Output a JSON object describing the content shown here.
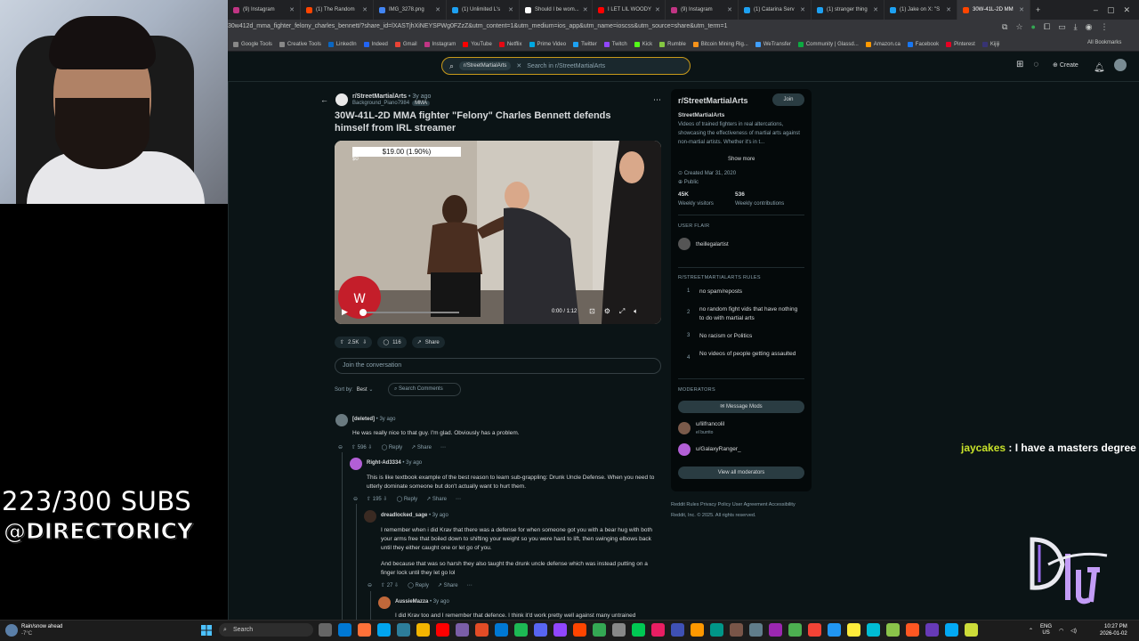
{
  "overlay": {
    "subs": "223/300 SUBS",
    "handle": "@DIRECTORICY",
    "chat_nick": "jaycakes",
    "chat_message": " : I have a masters degree"
  },
  "browser": {
    "tabs": [
      {
        "label": "(9) Instagram",
        "color": "#c13584"
      },
      {
        "label": "(1) The Random",
        "color": "#ff4500"
      },
      {
        "label": "IMG_3278.png",
        "color": "#4285f4"
      },
      {
        "label": "(1) Unlimited L's",
        "color": "#1da1f2"
      },
      {
        "label": "Should I be wom...",
        "color": "#ffffff"
      },
      {
        "label": "I LET LIL WOODY",
        "color": "#ff0000"
      },
      {
        "label": "(9) Instagram",
        "color": "#c13584"
      },
      {
        "label": "(1) Catarina Serv",
        "color": "#1da1f2"
      },
      {
        "label": "(1) stranger thing",
        "color": "#1da1f2"
      },
      {
        "label": "(1) Jake on X: \"S",
        "color": "#1da1f2"
      },
      {
        "label": "30W-41L-2D MM",
        "color": "#ff4500"
      }
    ],
    "url": "30w412d_mma_fighter_felony_charles_bennett/?share_id=lXASTjhXiNEYSPWg0FZzZ&utm_content=1&utm_medium=ios_app&utm_name=ioscss&utm_source=share&utm_term=1",
    "bookmarks": [
      {
        "label": "Google Tools",
        "color": "#888"
      },
      {
        "label": "Creative Tools",
        "color": "#888"
      },
      {
        "label": "LinkedIn",
        "color": "#0a66c2"
      },
      {
        "label": "Indeed",
        "color": "#2164f3"
      },
      {
        "label": "Gmail",
        "color": "#ea4335"
      },
      {
        "label": "Instagram",
        "color": "#c13584"
      },
      {
        "label": "YouTube",
        "color": "#ff0000"
      },
      {
        "label": "Netflix",
        "color": "#e50914"
      },
      {
        "label": "Prime Video",
        "color": "#00a8e1"
      },
      {
        "label": "Twitter",
        "color": "#1da1f2"
      },
      {
        "label": "Twitch",
        "color": "#9146ff"
      },
      {
        "label": "Kick",
        "color": "#53fc18"
      },
      {
        "label": "Rumble",
        "color": "#85c742"
      },
      {
        "label": "Bitcoin Mining Rig...",
        "color": "#f7931a"
      },
      {
        "label": "WeTransfer",
        "color": "#409fff"
      },
      {
        "label": "Community | Glassd...",
        "color": "#0caa41"
      },
      {
        "label": "Amazon.ca",
        "color": "#ff9900"
      },
      {
        "label": "Facebook",
        "color": "#1877f2"
      },
      {
        "label": "Pinterest",
        "color": "#e60023"
      },
      {
        "label": "Kijiji",
        "color": "#373373"
      }
    ],
    "all_bookmarks": "All Bookmarks"
  },
  "reddit": {
    "search_chip": "r/StreetMartialArts",
    "search_placeholder": "Search in r/StreetMartialArts",
    "create_label": "Create",
    "post": {
      "subreddit": "r/StreetMartialArts",
      "time": " • 3y ago",
      "user": "Background_Piano7984",
      "flair": "MMA",
      "title": "30W-41L-2D MMA fighter \"Felony\" Charles Bennett defends himself from IRL streamer",
      "donation": "$19.00 (1.90%)",
      "donation_sub": "$0",
      "video_time": "0:00 / 1:12",
      "votes": "2.5K",
      "comments": "116",
      "share": "Share",
      "join_placeholder": "Join the conversation",
      "sort_label": "Sort by:",
      "sort_value": "Best",
      "search_comments": "Search Comments"
    },
    "comments": [
      {
        "user": "[deleted]",
        "time": " • 3y ago",
        "text": "He was really nice to that guy. I'm glad. Obviously has a problem.",
        "votes": "596",
        "reply": "Reply",
        "share": "Share"
      },
      {
        "user": "Right-Ad3334",
        "time": " • 3y ago",
        "text": "This is like textbook example of the best reason to learn sub-grappling: Drunk Uncle Defense. When you need to utterly dominate someone but don't actually want to hurt them.",
        "votes": "195",
        "reply": "Reply",
        "share": "Share"
      },
      {
        "user": "dreadlocked_sage",
        "time": " • 3y ago",
        "text": "I remember when i did Krav that there was a defense for when someone got you with a bear hug with both your arms free that boiled down to shifting your weight so you were hard to lift, then swinging elbows back until they either caught one or let go of you.",
        "text2": "And because that was so harsh they also taught the drunk uncle defense which was instead putting on a finger lock until they let go lol",
        "votes": "27",
        "reply": "Reply",
        "share": "Share"
      },
      {
        "user": "AussieMazza",
        "time": " • 3y ago",
        "text": "I did Krav too and I remember that defence. I think it'd work pretty well against many untrained"
      }
    ],
    "sidebar": {
      "title": "r/StreetMartialArts",
      "join": "Join",
      "name": "StreetMartialArts",
      "description": "Videos of trained fighters in real altercations, showcasing the effectiveness of martial arts against non-martial artists. Whether it's in t...",
      "show_more": "Show more",
      "created": "Created Mar 31, 2020",
      "visibility": "Public",
      "visitors": "45K",
      "visitors_label": "Weekly visitors",
      "contributions": "536",
      "contributions_label": "Weekly contributions",
      "user_flair_head": "USER FLAIR",
      "user_flair": "theillegalartist",
      "rules_head": "R/STREETMARTIALARTS RULES",
      "rules": [
        {
          "n": "1",
          "t": "no spam/reposts"
        },
        {
          "n": "2",
          "t": "no random fight vids that have nothing to do with martial arts"
        },
        {
          "n": "3",
          "t": "No racism or Politics"
        },
        {
          "n": "4",
          "t": "No videos of people getting assaulted"
        }
      ],
      "mods_head": "MODERATORS",
      "message_mods": "Message Mods",
      "mods": [
        {
          "name": "u/lilfrancolil",
          "sub": "el burrito",
          "color": "#7a5a4a"
        },
        {
          "name": "u/GalaxyRanger_",
          "sub": "",
          "color": "#b25fd6"
        }
      ],
      "view_all": "View all moderators",
      "footer1": "Reddit Rules   Privacy Policy   User Agreement   Accessibility",
      "footer2": "Reddit, Inc. © 2025. All rights reserved."
    }
  },
  "taskbar": {
    "weather": "Rain/snow ahead",
    "temp": "-7°C",
    "search": "Search",
    "lang1": "ENG",
    "lang2": "US",
    "time": "10:27 PM",
    "date": "2026-01-02",
    "icon_colors": [
      "#666",
      "#0078d4",
      "#ff7139",
      "#00a4ef",
      "#2d7d9a",
      "#f4b400",
      "#ff0000",
      "#7b5ea7",
      "#e34c26",
      "#0078d4",
      "#1db954",
      "#5865f2",
      "#9146ff",
      "#ff4500",
      "#34a853",
      "#888",
      "#00c853",
      "#e91e63",
      "#3f51b5",
      "#ff9800",
      "#009688",
      "#795548",
      "#607d8b",
      "#9c27b0",
      "#4caf50",
      "#f44336",
      "#2196f3",
      "#ffeb3b",
      "#00bcd4",
      "#8bc34a",
      "#ff5722",
      "#673ab7",
      "#03a9f4",
      "#cddc39"
    ]
  }
}
